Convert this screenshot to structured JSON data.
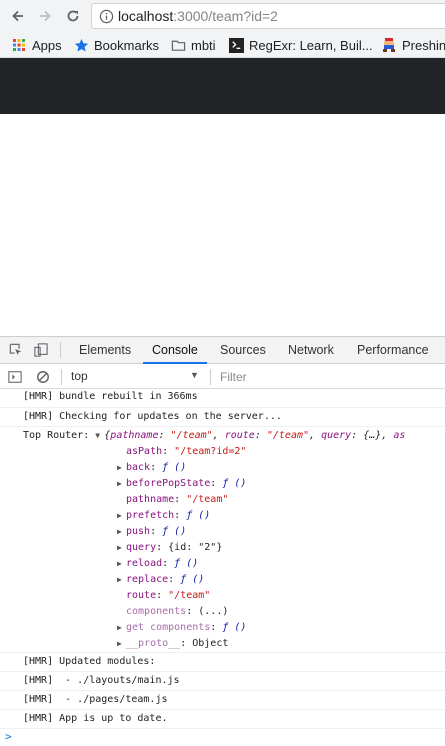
{
  "browser": {
    "url_host": "localhost",
    "url_path": ":3000/team?id=2",
    "bookmarks": [
      "Apps",
      "Bookmarks",
      "mbti",
      "RegExr: Learn, Buil...",
      "Preshin"
    ]
  },
  "devtools": {
    "tabs": [
      "Elements",
      "Console",
      "Sources",
      "Network",
      "Performance"
    ],
    "active_tab": "Console",
    "context": "top",
    "filter_placeholder": "Filter"
  },
  "console": {
    "line1": "[HMR] bundle rebuilt in 366ms",
    "line2": "[HMR] Checking for updates on the server...",
    "router_label": "Top Router:",
    "router_summary": {
      "open": "{",
      "k1": "pathname",
      "v1": "\"/team\"",
      "k2": "route",
      "v2": "\"/team\"",
      "k3": "query",
      "v3": "{…}",
      "k4": "as"
    },
    "props": {
      "asPath": {
        "key": "asPath",
        "value": "\"/team?id=2\""
      },
      "back": {
        "key": "back",
        "value": "ƒ ()"
      },
      "beforePopState": {
        "key": "beforePopState",
        "value": "ƒ ()"
      },
      "pathname": {
        "key": "pathname",
        "value": "\"/team\""
      },
      "prefetch": {
        "key": "prefetch",
        "value": "ƒ ()"
      },
      "push": {
        "key": "push",
        "value": "ƒ ()"
      },
      "query": {
        "key": "query",
        "value": "{id: \"2\"}"
      },
      "reload": {
        "key": "reload",
        "value": "ƒ ()"
      },
      "replace": {
        "key": "replace",
        "value": "ƒ ()"
      },
      "route": {
        "key": "route",
        "value": "\"/team\""
      },
      "components": {
        "key": "components",
        "value": "(...)"
      },
      "get_components": {
        "key": "get components",
        "value": "ƒ ()"
      },
      "proto": {
        "key": "__proto__",
        "value": "Object"
      }
    },
    "line3": "[HMR] Updated modules:",
    "line4": "[HMR]  - ./layouts/main.js",
    "line5": "[HMR]  - ./pages/team.js",
    "line6": "[HMR] App is up to date.",
    "prompt": ">"
  }
}
